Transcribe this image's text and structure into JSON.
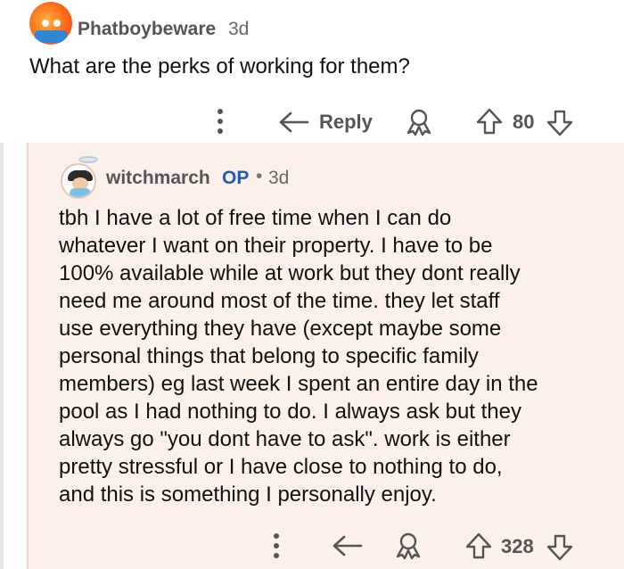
{
  "parent_comment": {
    "username": "Phatboybeware",
    "age": "3d",
    "text": "What are the perks of working for them?",
    "actions": {
      "reply_label": "Reply",
      "score": "80"
    },
    "avatar_icon": "fire-mascot-avatar-icon"
  },
  "reply_comment": {
    "username": "witchmarch",
    "op_badge": "OP",
    "separator": "•",
    "age": "3d",
    "lines": [
      "tbh I have a lot of free time when I can do",
      "whatever I want on their property. I have to be",
      "100% available while at work but they dont really",
      "need me around most of the time. they let staff",
      "use everything they have (except maybe some",
      "personal things that belong to specific family",
      "members) eg last week I spent an entire day in the",
      "pool as I had nothing to do. I always ask but they",
      "always go \"you dont have to ask\". work is either",
      "pretty stressful or I have close to nothing to do,",
      "and this is something I personally enjoy."
    ],
    "actions": {
      "score": "328"
    },
    "avatar_icon": "girl-avatar-icon"
  },
  "colors": {
    "reply_background": "#fcf0ea",
    "op_blue": "#1f5bb8",
    "action_gray": "#555555"
  }
}
